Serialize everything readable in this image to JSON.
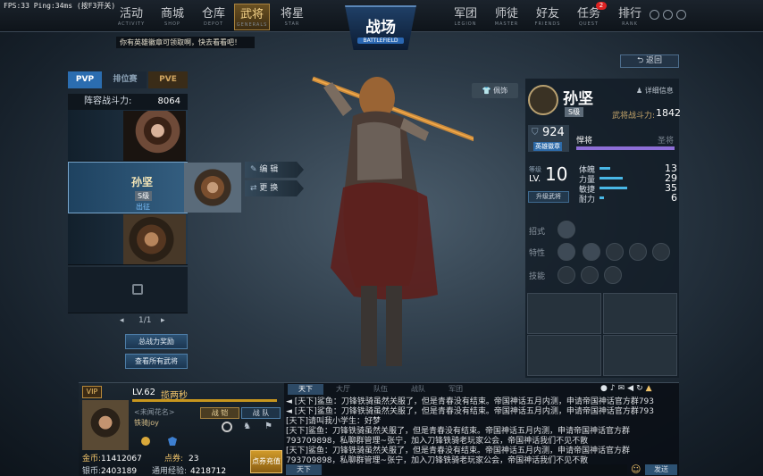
{
  "status_bar": "FPS:33  Ping:34ms  (按F3开关)",
  "nav_left": [
    {
      "label": "活动",
      "sub": "ACTIVITY"
    },
    {
      "label": "商城",
      "sub": "SHOP"
    },
    {
      "label": "仓库",
      "sub": "DEPOT"
    },
    {
      "label": "武将",
      "sub": "GENERALS"
    },
    {
      "label": "将星",
      "sub": "STAR"
    }
  ],
  "nav_right": [
    {
      "label": "军团",
      "sub": "LEGION"
    },
    {
      "label": "师徒",
      "sub": "MASTER"
    },
    {
      "label": "好友",
      "sub": "FRIENDS"
    },
    {
      "label": "任务",
      "sub": "QUEST"
    },
    {
      "label": "排行",
      "sub": "RANK"
    }
  ],
  "task_badge": "2",
  "emblem": {
    "title": "战场",
    "subtitle": "BATTLEFIELD"
  },
  "notice": "你有英雄徽章可领取啊，快去看看吧！",
  "mode_tabs": [
    "PVP",
    "排位赛",
    "PVE"
  ],
  "lineup": {
    "label": "阵容战斗力:",
    "value": "8064"
  },
  "selected_general": {
    "name": "孙坚",
    "grade": "S级",
    "status": "出征"
  },
  "actions": [
    "编 辑",
    "更 换"
  ],
  "pager": "1/1",
  "left_buttons": [
    "总战力奖励",
    "查看所有武将"
  ],
  "back": "返回",
  "ornament": "佩饰",
  "detail_info": "详细信息",
  "hero": {
    "name": "孙坚",
    "grade": "S级",
    "power_label": "武将战斗力:",
    "power": "1842",
    "medals": "924",
    "medal_label": "英雄徽章",
    "rank": "悍将",
    "next_rank": "圣将",
    "level_label": "等级",
    "level": "10",
    "lv": "LV.",
    "upgrade": "升级武将"
  },
  "stats": [
    {
      "name": "体魄",
      "value": "13",
      "pct": 0.13
    },
    {
      "name": "力量",
      "value": "29",
      "pct": 0.29
    },
    {
      "name": "敏捷",
      "value": "35",
      "pct": 0.35
    },
    {
      "name": "耐力",
      "value": "6",
      "pct": 0.06
    }
  ],
  "skill_rows": [
    "招式",
    "特性",
    "技能"
  ],
  "player": {
    "level": "LV.62",
    "title": "揽两秒",
    "tag": "<未闻花名>",
    "name": "铁骑joy",
    "gold_label": "金币:",
    "gold": "11412067",
    "points_label": "点券:",
    "points": "23",
    "silver_label": "银币:",
    "silver": "2403189",
    "exp_label": "通用经验:",
    "exp": "4218712",
    "recharge": "点券充值",
    "btn_team": "战 队",
    "btn_armor": "战 铠"
  },
  "chat_tabs": [
    "天下",
    "大厅",
    "队伍",
    "战队",
    "军团"
  ],
  "chat_lines": [
    "[天下]鲨鱼：刀锋铁骑虽然关服了，但是青春没有结束。帝国神话五月内测，申请帝国神话官方群793",
    "[天下]鲨鱼：刀锋铁骑虽然关服了，但是青春没有结束。帝国神话五月内测，申请帝国神话官方群793",
    "[天下]请叫我小学生：好梦",
    "[天下]鲨鱼：刀锋铁骑虽然关服了，但是青春没有结束。帝国神话五月内测，申请帝国神话官方群",
    "793709898，私聊群管理~张宁，加入刀锋铁骑老玩家公会，帝国神话我们不见不散",
    "[天下]鲨鱼：刀锋铁骑虽然关服了，但是青春没有结束。帝国神话五月内测，申请帝国神话官方群",
    "793709898，私聊群管理~张宁，加入刀锋铁骑老玩家公会，帝国神话我们不见不散"
  ],
  "chat_channel": "天下",
  "send": "发送",
  "colors": {
    "accent": "#f0c36a",
    "blue": "#49b7e6",
    "purple": "#8e6fd8"
  }
}
